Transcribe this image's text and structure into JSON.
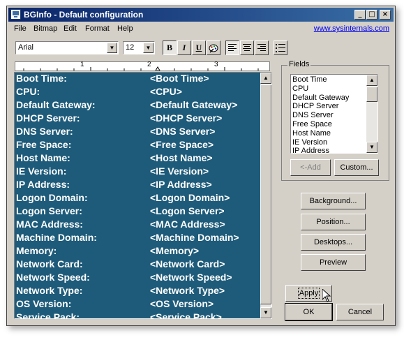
{
  "window": {
    "title": "BGInfo - Default configuration"
  },
  "titlebar_buttons": {
    "minimize": "_",
    "maximize": "□",
    "close": "×"
  },
  "menu": [
    "File",
    "Bitmap",
    "Edit",
    "Format",
    "Help"
  ],
  "menu_link": "www.sysinternals.com",
  "toolbar": {
    "font_value": "Arial",
    "size_value": "12",
    "bold": "B",
    "italic": "I",
    "underline": "U",
    "dropdown_arrow": "▼"
  },
  "ruler": {
    "ticks": [
      "1",
      "2",
      "3"
    ]
  },
  "rows": [
    {
      "label": "Boot Time:",
      "value": "<Boot Time>"
    },
    {
      "label": "CPU:",
      "value": "<CPU>"
    },
    {
      "label": "Default Gateway:",
      "value": "<Default Gateway>"
    },
    {
      "label": "DHCP Server:",
      "value": "<DHCP Server>"
    },
    {
      "label": "DNS Server:",
      "value": "<DNS Server>"
    },
    {
      "label": "Free Space:",
      "value": "<Free Space>"
    },
    {
      "label": "Host Name:",
      "value": "<Host Name>"
    },
    {
      "label": "IE Version:",
      "value": "<IE Version>"
    },
    {
      "label": "IP Address:",
      "value": "<IP Address>"
    },
    {
      "label": "Logon Domain:",
      "value": "<Logon Domain>"
    },
    {
      "label": "Logon Server:",
      "value": "<Logon Server>"
    },
    {
      "label": "MAC Address:",
      "value": "<MAC Address>"
    },
    {
      "label": "Machine Domain:",
      "value": "<Machine Domain>"
    },
    {
      "label": "Memory:",
      "value": "<Memory>"
    },
    {
      "label": "Network Card:",
      "value": "<Network Card>"
    },
    {
      "label": "Network Speed:",
      "value": "<Network Speed>"
    },
    {
      "label": "Network Type:",
      "value": "<Network Type>"
    },
    {
      "label": "OS Version:",
      "value": "<OS Version>"
    },
    {
      "label": "Service Pack:",
      "value": "<Service Pack>"
    }
  ],
  "fields": {
    "legend": "Fields",
    "items": [
      "Boot Time",
      "CPU",
      "Default Gateway",
      "DHCP Server",
      "DNS Server",
      "Free Space",
      "Host Name",
      "IE Version",
      "IP Address"
    ],
    "add_button": "<-Add",
    "custom_button": "Custom..."
  },
  "scroll_arrows": {
    "up": "▲",
    "down": "▼"
  },
  "buttons": {
    "background": "Background...",
    "position": "Position...",
    "desktops": "Desktops...",
    "preview": "Preview",
    "apply": "Apply",
    "ok": "OK",
    "cancel": "Cancel"
  },
  "colors": {
    "editor_bg": "#1e5b7a",
    "title_start": "#0a246a",
    "title_end": "#3a6ea5"
  }
}
